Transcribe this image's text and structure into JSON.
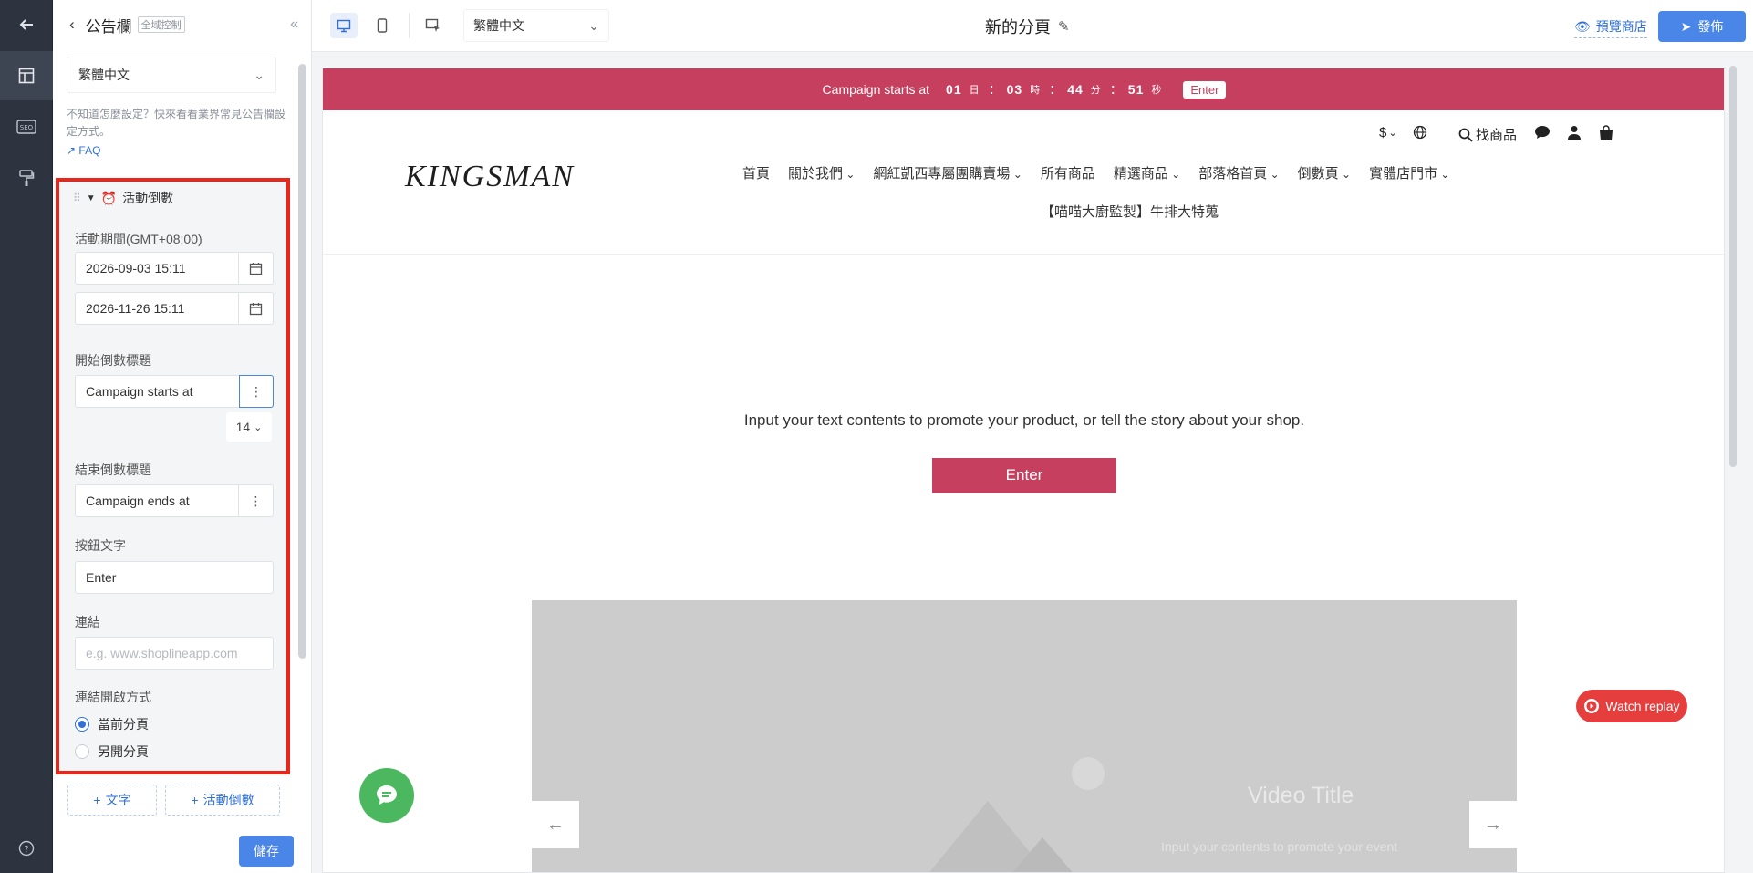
{
  "rail": {
    "items": [
      "back-arrow-icon",
      "layout-icon",
      "seo-icon",
      "paint-icon",
      "help-icon"
    ]
  },
  "panel": {
    "title": "公告欄",
    "tag": "全域控制",
    "language": "繁體中文",
    "hint": "不知道怎麼設定？快來看看業界常見公告欄設定方式。",
    "faq": "FAQ",
    "section_title": "活動倒數",
    "period_label": "活動期間(GMT+08:00)",
    "start_date": "2026-09-03 15:11",
    "end_date": "2026-11-26 15:11",
    "start_title_label": "開始倒數標題",
    "start_title_value": "Campaign starts at",
    "font_size": "14",
    "end_title_label": "結束倒數標題",
    "end_title_value": "Campaign ends at",
    "button_text_label": "按鈕文字",
    "button_text_value": "Enter",
    "link_label": "連結",
    "link_placeholder": "e.g. www.shoplineapp.com",
    "open_mode_label": "連結開啟方式",
    "open_current": "當前分頁",
    "open_new": "另開分頁",
    "add_text": "文字",
    "add_countdown": "活動倒數",
    "save": "儲存"
  },
  "topbar": {
    "language": "繁體中文",
    "page_title": "新的分頁",
    "preview": "預覽商店",
    "publish": "發佈"
  },
  "site": {
    "announce": {
      "text": "Campaign starts at",
      "d": "01",
      "d_unit": "日",
      "h": "03",
      "h_unit": "時",
      "m": "44",
      "m_unit": "分",
      "s": "51",
      "s_unit": "秒",
      "sep": "：",
      "button": "Enter"
    },
    "utility": {
      "currency": "$",
      "search": "找商品"
    },
    "logo": "KINGSMAN",
    "nav": [
      "首頁",
      "關於我們",
      "網紅凱西專屬團購賣場",
      "所有商品",
      "精選商品",
      "部落格首頁",
      "倒數頁",
      "實體店門市"
    ],
    "nav2": "【喵喵大廚監製】牛排大特蒐",
    "hero_text": "Input your text contents to promote your product, or tell the story about your shop.",
    "hero_button": "Enter",
    "video_title": "Video Title",
    "video_sub": "Input your contents to promote your event",
    "watch_replay": "Watch replay"
  },
  "colors": {
    "accent": "#4a86e8",
    "brand": "#c63f5e",
    "highlight": "#e8261c",
    "chat": "#4bb860"
  }
}
